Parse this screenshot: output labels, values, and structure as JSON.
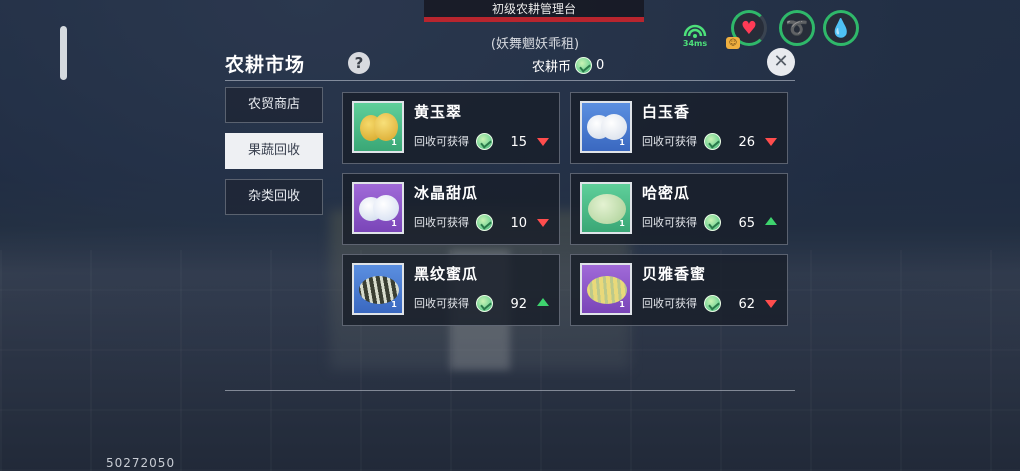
{
  "hud": {
    "location_title": "初级农耕管理台",
    "subtitle": "(妖舞魍妖乖租)",
    "ping": "34ms",
    "status_icons": [
      "heart-icon",
      "food-icon",
      "water-drop-icon"
    ],
    "colors": {
      "hp_bar": "#b8252e",
      "ping": "#4de07a",
      "status_ring": "#2fb86a"
    }
  },
  "panel": {
    "title": "农耕市场",
    "help_label": "?",
    "currency_label": "农耕币",
    "currency_value": "0",
    "close_label": "✕"
  },
  "tabs": [
    {
      "label": "农贸商店",
      "active": false
    },
    {
      "label": "果蔬回收",
      "active": true
    },
    {
      "label": "杂类回收",
      "active": false
    }
  ],
  "items": [
    {
      "name": "黄玉翠",
      "recycle_label": "回收可获得",
      "price": "15",
      "trend": "down",
      "level": "1",
      "icon": "yellow-melon-icon"
    },
    {
      "name": "白玉香",
      "recycle_label": "回收可获得",
      "price": "26",
      "trend": "down",
      "level": "1",
      "icon": "white-melon-icon"
    },
    {
      "name": "冰晶甜瓜",
      "recycle_label": "回收可获得",
      "price": "10",
      "trend": "down",
      "level": "1",
      "icon": "ice-melon-icon"
    },
    {
      "name": "哈密瓜",
      "recycle_label": "回收可获得",
      "price": "65",
      "trend": "up",
      "level": "1",
      "icon": "hami-melon-icon"
    },
    {
      "name": "黑纹蜜瓜",
      "recycle_label": "回收可获得",
      "price": "92",
      "trend": "up",
      "level": "1",
      "icon": "striped-melon-icon"
    },
    {
      "name": "贝雅香蜜",
      "recycle_label": "回收可获得",
      "price": "62",
      "trend": "down",
      "level": "1",
      "icon": "beiya-melon-icon"
    }
  ],
  "footer": {
    "uid": "50272050"
  },
  "colors": {
    "trend_up": "#3ed46e",
    "trend_down": "#ff4d4d",
    "active_tab_bg": "#eef0f3"
  }
}
